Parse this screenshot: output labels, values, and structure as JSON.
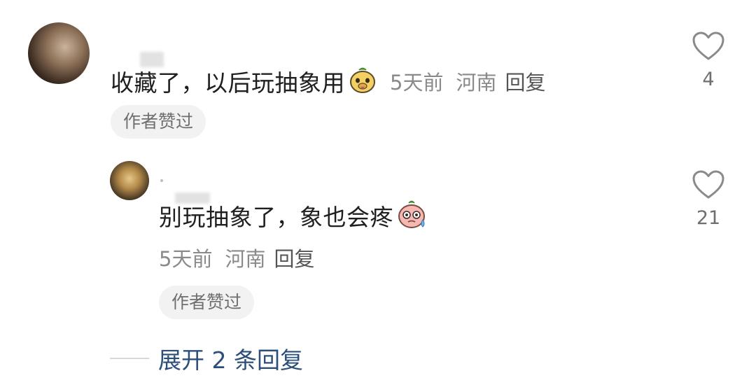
{
  "comment": {
    "text": "收藏了，以后玩抽象用",
    "emoji": "dog-face-emoji",
    "time": "5天前",
    "location": "河南",
    "reply_label": "回复",
    "author_badge": "作者赞过",
    "like_count": "4"
  },
  "reply": {
    "text": "别玩抽象了，象也会疼",
    "emoji": "sweating-face-emoji",
    "time": "5天前",
    "location": "河南",
    "reply_label": "回复",
    "author_badge": "作者赞过",
    "like_count": "21"
  },
  "expand_replies_label": "展开 2 条回复",
  "colors": {
    "text": "#1f1f1f",
    "meta": "#8a8a8a",
    "badge_bg": "#f2f2f2",
    "expand_link": "#2b4f7a"
  }
}
